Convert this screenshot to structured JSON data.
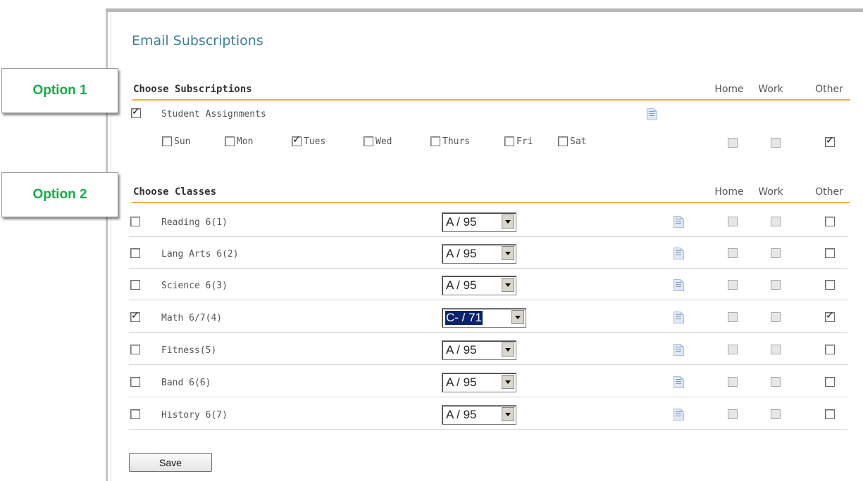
{
  "page": {
    "title": "Email Subscriptions"
  },
  "callouts": {
    "option1": "Option 1",
    "option2": "Option 2"
  },
  "subscriptions": {
    "header": "Choose Subscriptions",
    "columns": {
      "home": "Home",
      "work": "Work",
      "other": "Other"
    },
    "item": {
      "label": "Student Assignments",
      "checked": true
    },
    "days": [
      {
        "label": "Sun",
        "checked": false
      },
      {
        "label": "Mon",
        "checked": false
      },
      {
        "label": "Tues",
        "checked": true
      },
      {
        "label": "Wed",
        "checked": false
      },
      {
        "label": "Thurs",
        "checked": false
      },
      {
        "label": "Fri",
        "checked": false
      },
      {
        "label": "Sat",
        "checked": false
      }
    ],
    "delivery": {
      "home": false,
      "work": false,
      "other": true
    }
  },
  "classes": {
    "header": "Choose Classes",
    "columns": {
      "home": "Home",
      "work": "Work",
      "other": "Other"
    },
    "rows": [
      {
        "name": "Reading 6(1)",
        "checked": false,
        "grade": "A / 95",
        "other": false
      },
      {
        "name": "Lang Arts 6(2)",
        "checked": false,
        "grade": "A / 95",
        "other": false
      },
      {
        "name": "Science 6(3)",
        "checked": false,
        "grade": "A / 95",
        "other": false
      },
      {
        "name": "Math 6/7(4)",
        "checked": true,
        "grade": "C- / 71",
        "other": true
      },
      {
        "name": "Fitness(5)",
        "checked": false,
        "grade": "A / 95",
        "other": false
      },
      {
        "name": "Band 6(6)",
        "checked": false,
        "grade": "A / 95",
        "other": false
      },
      {
        "name": "History 6(7)",
        "checked": false,
        "grade": "A / 95",
        "other": false
      }
    ]
  },
  "actions": {
    "save_label": "Save"
  }
}
